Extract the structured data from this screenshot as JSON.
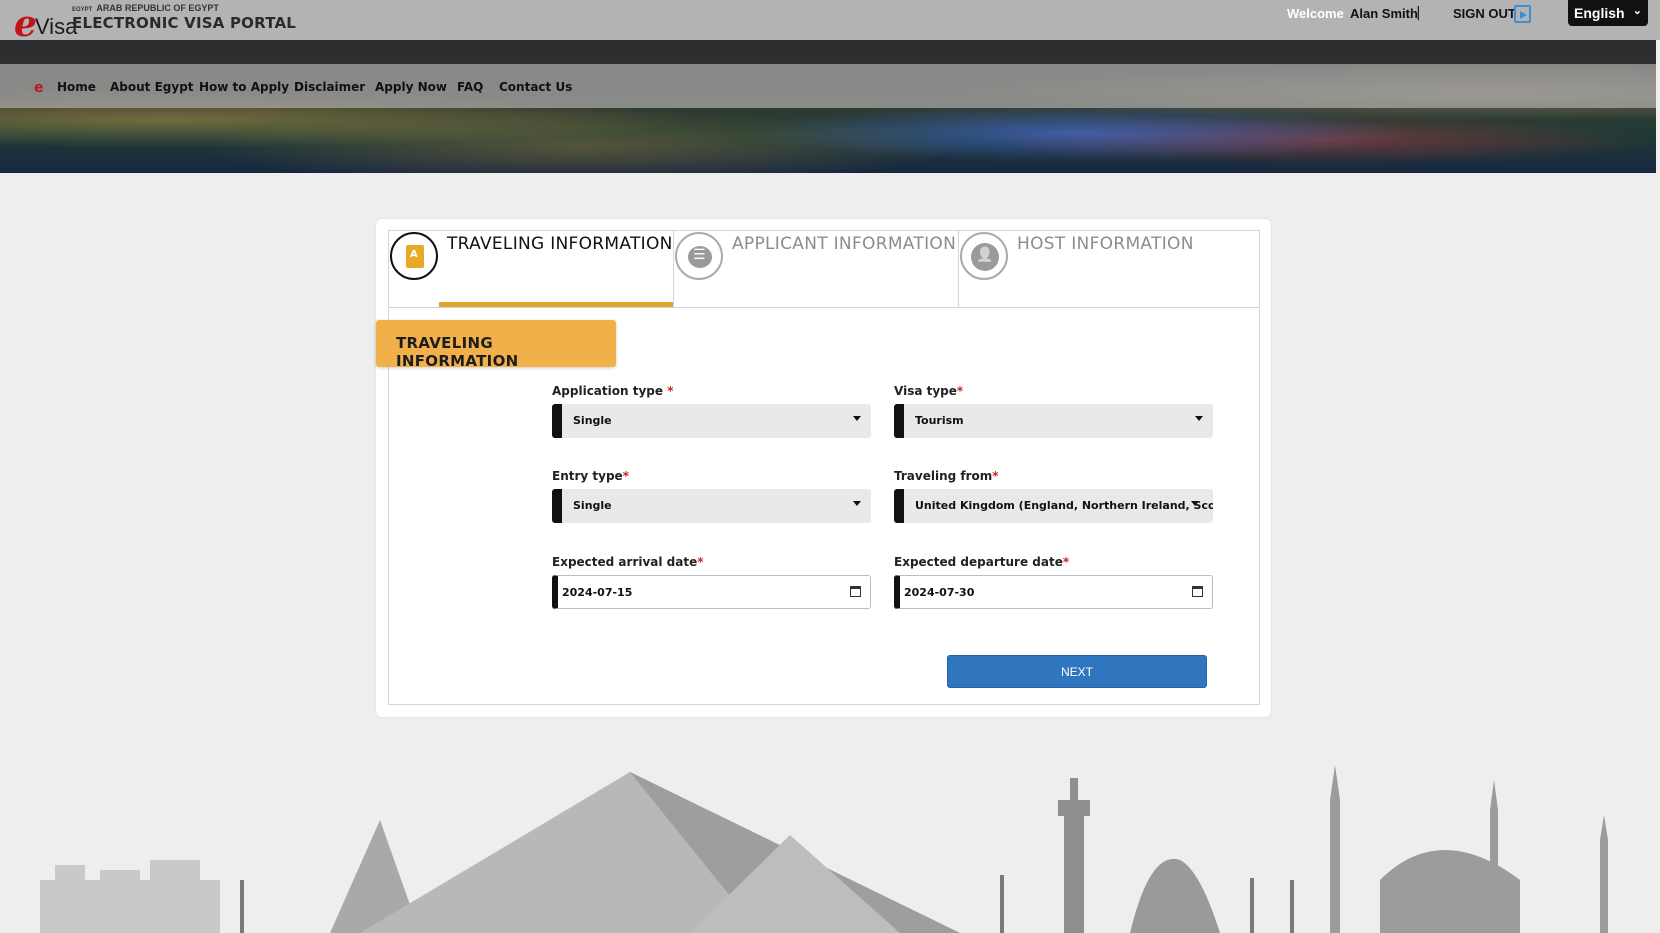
{
  "header": {
    "logo_mark": "e",
    "logo_visa": "Visa",
    "logo_country_small": "EGYPT",
    "logo_country": "ARAB REPUBLIC OF EGYPT",
    "portal_title": "ELECTRONIC VISA PORTAL",
    "welcome_label": "Welcome",
    "user_name": "Alan Smith",
    "separator": "|",
    "signout_label": "SIGN OUT",
    "language": "English"
  },
  "nav": {
    "items": [
      {
        "label": "Home"
      },
      {
        "label": "About Egypt"
      },
      {
        "label": "How to Apply"
      },
      {
        "label": "Disclaimer"
      },
      {
        "label": "Apply Now"
      },
      {
        "label": "FAQ"
      },
      {
        "label": "Contact Us"
      }
    ]
  },
  "steps": [
    {
      "label": "TRAVELING INFORMATION",
      "icon": "document-icon",
      "state": "active"
    },
    {
      "label": "APPLICANT INFORMATION",
      "icon": "list-icon",
      "state": "inactive"
    },
    {
      "label": "HOST INFORMATION",
      "icon": "user-icon",
      "state": "inactive"
    }
  ],
  "section_title": "TRAVELING INFORMATION",
  "form": {
    "application_type": {
      "label": "Application type",
      "required": "*",
      "value": "Single"
    },
    "visa_type": {
      "label": "Visa type",
      "required": "*",
      "value": "Tourism"
    },
    "entry_type": {
      "label": "Entry type",
      "required": "*",
      "value": "Single"
    },
    "traveling_from": {
      "label": "Traveling from",
      "required": "*",
      "value": "United Kingdom (England, Northern Ireland, Scotland and Wales)"
    },
    "arrival_date": {
      "label": "Expected arrival date",
      "required": "*",
      "value": "2024-07-15"
    },
    "departure_date": {
      "label": "Expected departure date",
      "required": "*",
      "value": "2024-07-30"
    }
  },
  "next_button": "NEXT",
  "colors": {
    "accent_orange": "#f2b04b",
    "tab_underline": "#e2a42b",
    "button_blue": "#2f76be",
    "required_red": "#d31d1d"
  }
}
